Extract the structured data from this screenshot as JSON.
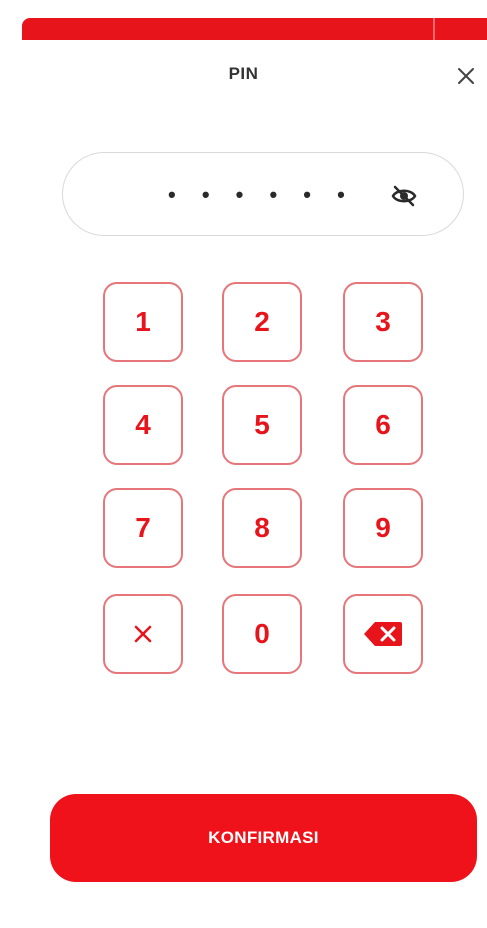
{
  "header": {
    "title": "PIN",
    "close_icon": "close-icon"
  },
  "pin_field": {
    "masked_value": "• • • • • •",
    "toggle_icon": "eye-off-icon"
  },
  "keypad": {
    "keys": [
      {
        "label": "1"
      },
      {
        "label": "2"
      },
      {
        "label": "3"
      },
      {
        "label": "4"
      },
      {
        "label": "5"
      },
      {
        "label": "6"
      },
      {
        "label": "7"
      },
      {
        "label": "8"
      },
      {
        "label": "9"
      },
      {
        "label": "",
        "icon": "clear-icon"
      },
      {
        "label": "0"
      },
      {
        "label": "",
        "icon": "backspace-icon"
      }
    ]
  },
  "footer": {
    "confirm_label": "KONFIRMASI"
  },
  "colors": {
    "accent": "#e8141c",
    "key_border": "#e6767a",
    "field_border": "#d9d9d9"
  }
}
